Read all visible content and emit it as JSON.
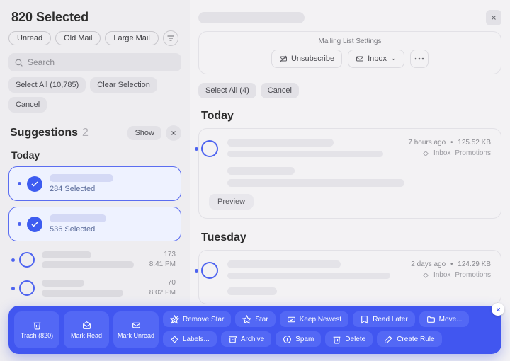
{
  "sidebar": {
    "title": "820 Selected",
    "filter_chips": [
      "Unread",
      "Old Mail",
      "Large Mail"
    ],
    "search_placeholder": "Search",
    "select_all_label": "Select All (10,785)",
    "clear_selection_label": "Clear Selection",
    "cancel_label": "Cancel",
    "suggestions_label": "Suggestions",
    "suggestions_count": "2",
    "suggestions_show": "Show",
    "day_headers": {
      "today": "Today"
    },
    "selected_cards": [
      {
        "sub": "284 Selected"
      },
      {
        "sub": "536 Selected"
      }
    ],
    "rows": [
      {
        "count": "173",
        "time": "8:41 PM"
      },
      {
        "count": "70",
        "time": "8:02 PM"
      }
    ]
  },
  "main": {
    "list_settings_title": "Mailing List Settings",
    "unsubscribe_label": "Unsubscribe",
    "inbox_label": "Inbox",
    "select_all_label": "Select All (4)",
    "cancel_label": "Cancel",
    "sections": {
      "today": "Today",
      "tuesday": "Tuesday"
    },
    "messages": [
      {
        "age": "7 hours ago",
        "size": "125.52 KB",
        "tag1": "Inbox",
        "tag2": "Promotions",
        "preview": "Preview"
      },
      {
        "age": "2 days ago",
        "size": "124.29 KB",
        "tag1": "Inbox",
        "tag2": "Promotions"
      }
    ]
  },
  "actionbar": {
    "primary": [
      {
        "label": "Trash (820)",
        "icon": "trash"
      },
      {
        "label": "Mark Read",
        "icon": "mail-open"
      },
      {
        "label": "Mark Unread",
        "icon": "mail"
      }
    ],
    "secondary": [
      {
        "label": "Remove Star",
        "icon": "star-off"
      },
      {
        "label": "Star",
        "icon": "star"
      },
      {
        "label": "Keep Newest",
        "icon": "mail-check"
      },
      {
        "label": "Read Later",
        "icon": "bookmark"
      },
      {
        "label": "Move...",
        "icon": "folder"
      },
      {
        "label": "Labels...",
        "icon": "tag"
      },
      {
        "label": "Archive",
        "icon": "archive"
      },
      {
        "label": "Spam",
        "icon": "alert"
      },
      {
        "label": "Delete",
        "icon": "trash"
      },
      {
        "label": "Create Rule",
        "icon": "wand"
      }
    ]
  }
}
